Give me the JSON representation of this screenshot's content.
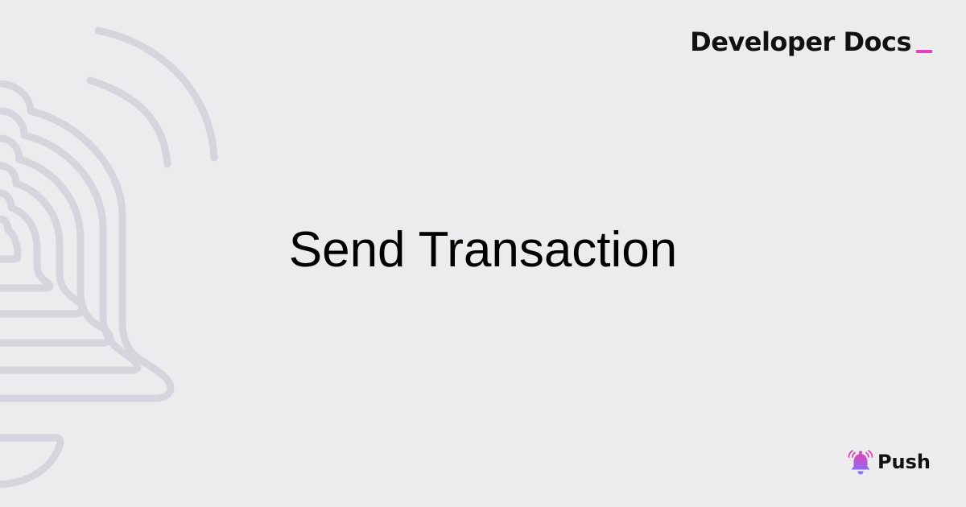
{
  "header": {
    "brand_label": "Developer Docs",
    "accent_color": "#dd44b9"
  },
  "main": {
    "title": "Send Transaction"
  },
  "footer": {
    "logo_label": "Push",
    "logo_icon": "bell-icon"
  },
  "colors": {
    "background": "#ececee",
    "decoration": "#d6d5de",
    "bell_gradient_top": "#dd44b9",
    "bell_gradient_bottom": "#8b6ff0"
  }
}
